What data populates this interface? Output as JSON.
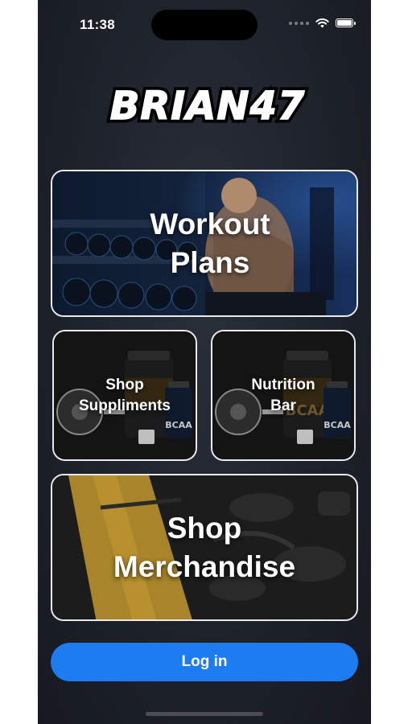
{
  "status_bar": {
    "time": "11:38",
    "icons": [
      "signal-dots-icon",
      "wifi-icon",
      "battery-icon"
    ],
    "battery_level": 1.0
  },
  "logo": {
    "text": "BRIAN47"
  },
  "cards": {
    "workout": {
      "label": "Workout\nPlans"
    },
    "supplements": {
      "label": "Shop\nSuppliments"
    },
    "nutrition": {
      "label": "Nutrition\nBar"
    },
    "merch": {
      "label": "Shop\nMerchandise"
    }
  },
  "supplement_image": {
    "tub_label": "BCAA",
    "bottle_label": "BCAA"
  },
  "login": {
    "label": "Log in"
  },
  "colors": {
    "accent": "#1e7cf2",
    "background": "#1e222b",
    "card_border": "#e9e9ee"
  }
}
